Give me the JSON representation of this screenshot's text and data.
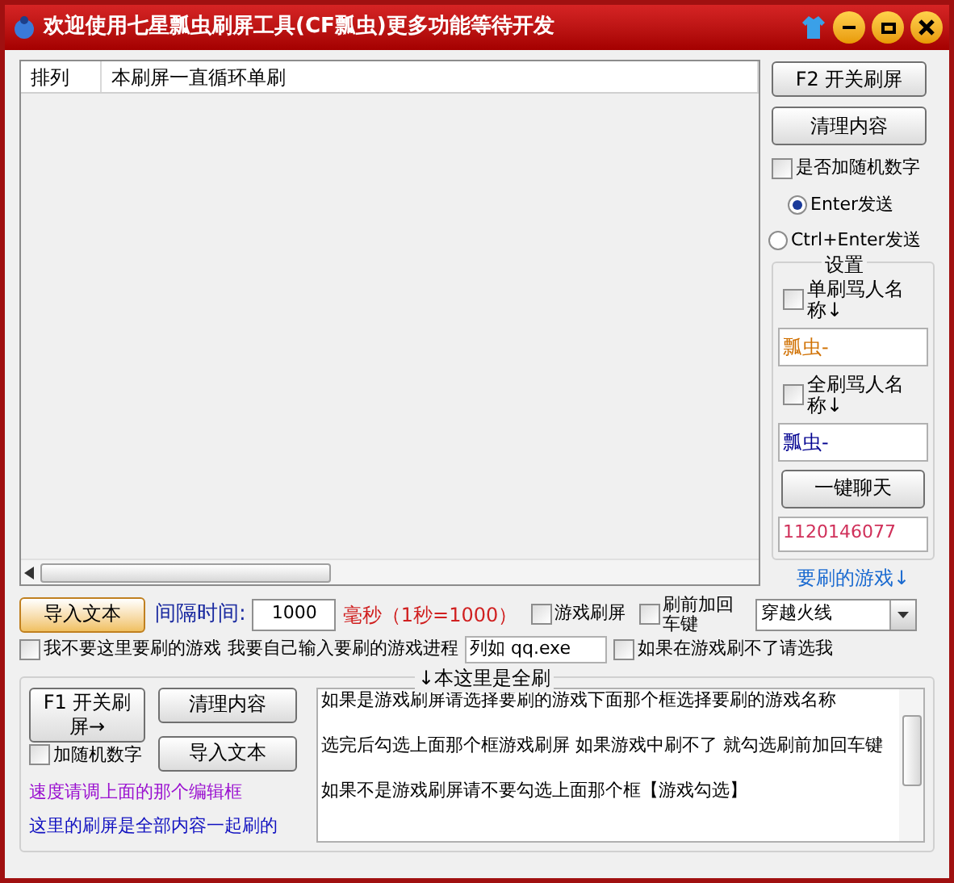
{
  "window": {
    "title": "欢迎使用七星瓢虫刷屏工具(CF瓢虫)更多功能等待开发"
  },
  "list": {
    "columns": [
      "排列",
      "本刷屏一直循环单刷"
    ]
  },
  "side": {
    "f2_button": "F2 开关刷屏",
    "clear_button": "清理内容",
    "random_checkbox": {
      "label": "是否加随机数字",
      "checked": false
    },
    "send_modes": [
      {
        "label": "Enter发送",
        "selected": true
      },
      {
        "label": "Ctrl+Enter发送",
        "selected": false
      }
    ],
    "settings": {
      "title": "设置",
      "single": {
        "label": "单刷骂人名称↓",
        "checked": false,
        "value": "瓢虫-",
        "color": "#d07000"
      },
      "all": {
        "label": "全刷骂人名称↓",
        "checked": false,
        "value": "瓢虫-",
        "color": "#000090"
      },
      "chat_button": "一键聊天",
      "qq_field": "1120146077"
    },
    "game_label": "要刷的游戏↓"
  },
  "row1": {
    "import_button": "导入文本",
    "interval_label": "间隔时间:",
    "interval_value": "1000",
    "unit": "毫秒（1秒=1000）",
    "game_checkbox": {
      "label": "游戏刷屏",
      "checked": false
    },
    "enter_checkbox": {
      "label": "刷前加回车键",
      "checked": false
    },
    "game_combo": "穿越火线"
  },
  "row2": {
    "no_game_checkbox": {
      "label": "我不要这里要刷的游戏",
      "checked": false
    },
    "process_label": "我要自己输入要刷的游戏进程",
    "process_field": "列如 qq.exe",
    "fallback_checkbox": {
      "label": "如果在游戏刷不了请选我",
      "checked": false
    }
  },
  "group": {
    "title": "↓本这里是全刷",
    "f1_button": "F1 开关刷屏→",
    "clear_button": "清理内容",
    "import_button": "导入文本",
    "random_checkbox": {
      "label": "加随机数字",
      "checked": false
    },
    "hint_speed": "速度请调上面的那个编辑框",
    "hint_all": "这里的刷屏是全部内容一起刷的",
    "memo_paragraphs": [
      "如果是游戏刷屏请选择要刷的游戏下面那个框选择要刷的游戏名称",
      "选完后勾选上面那个框游戏刷屏 如果游戏中刷不了 就勾选刷前加回车键",
      "如果不是游戏刷屏请不要勾选上面那个框【游戏勾选】"
    ]
  }
}
